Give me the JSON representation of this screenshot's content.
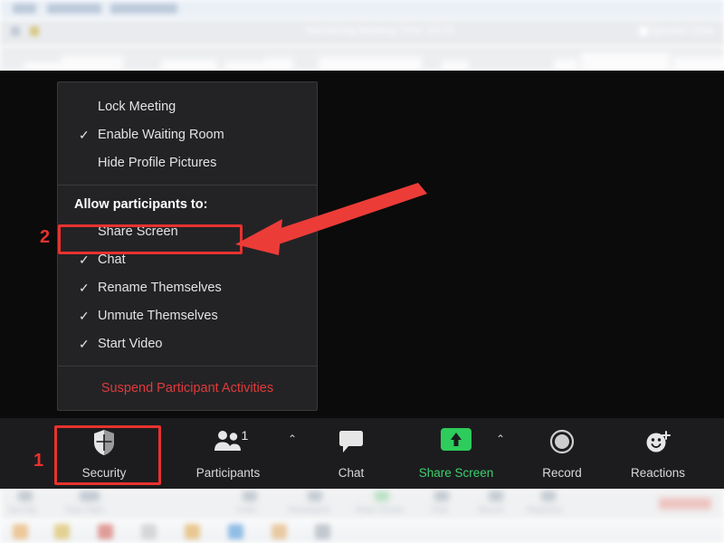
{
  "window": {
    "title": "Remaining Meeting Time: 53:23",
    "view_mode": "Speaker View"
  },
  "security_menu": {
    "items_top": [
      {
        "label": "Lock Meeting",
        "checked": false
      },
      {
        "label": "Enable Waiting Room",
        "checked": true
      },
      {
        "label": "Hide Profile Pictures",
        "checked": false
      }
    ],
    "section_header": "Allow participants to:",
    "items_allow": [
      {
        "label": "Share Screen",
        "checked": false,
        "highlighted": true
      },
      {
        "label": "Chat",
        "checked": true
      },
      {
        "label": "Rename Themselves",
        "checked": true
      },
      {
        "label": "Unmute Themselves",
        "checked": true
      },
      {
        "label": "Start Video",
        "checked": true
      }
    ],
    "suspend_label": "Suspend Participant Activities",
    "check_glyph": "✓"
  },
  "toolbar": {
    "security_label": "Security",
    "participants_label": "Participants",
    "participants_count": "1",
    "chat_label": "Chat",
    "share_label": "Share Screen",
    "record_label": "Record",
    "reactions_label": "Reactions",
    "chevron_glyph": "⌃"
  },
  "annotations": {
    "step_one": "1",
    "step_two": "2",
    "accent_color": "#e8322f",
    "share_accent_color": "#3bd16f",
    "suspend_color": "#e03a3a"
  },
  "ghost_toolbar": {
    "labels": [
      "Security",
      "Stop Video",
      "Invite",
      "Participants",
      "Share Screen",
      "Chat",
      "Record",
      "Reactions"
    ]
  }
}
